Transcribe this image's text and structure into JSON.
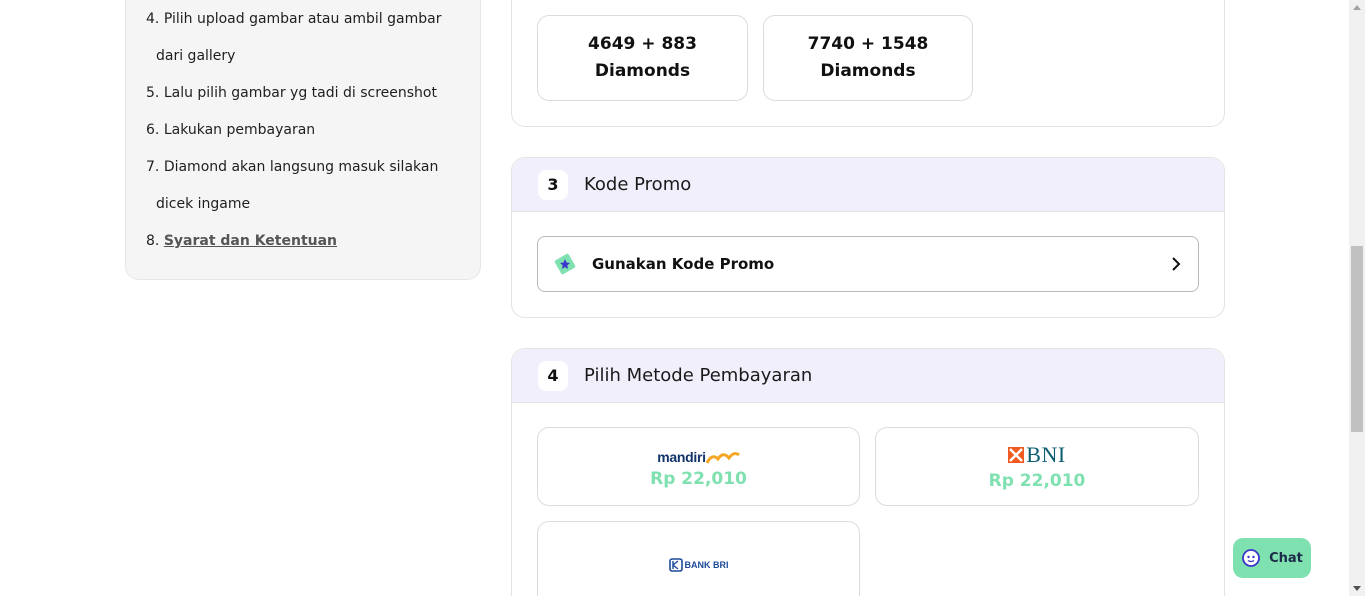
{
  "instructions": {
    "steps": [
      {
        "number": "4.",
        "text": "Pilih upload gambar atau ambil gambar",
        "continuation": "dari gallery"
      },
      {
        "number": "5.",
        "text": "Lalu pilih gambar yg tadi di screenshot"
      },
      {
        "number": "6.",
        "text": "Lakukan pembayaran"
      },
      {
        "number": "7.",
        "text": "Diamond akan langsung masuk silakan",
        "continuation": "dicek ingame"
      },
      {
        "number": "8.",
        "link_text": "Syarat dan Ketentuan"
      }
    ]
  },
  "nominal": {
    "options": [
      {
        "amount": "4649 + 883",
        "unit": "Diamonds"
      },
      {
        "amount": "7740 + 1548",
        "unit": "Diamonds"
      }
    ]
  },
  "promo_section": {
    "number": "3",
    "title": "Kode Promo",
    "button_label": "Gunakan Kode Promo",
    "icon": "ticket-star-icon"
  },
  "payment_section": {
    "number": "4",
    "title": "Pilih Metode Pembayaran",
    "methods": [
      {
        "name": "mandiri",
        "price": "Rp 22,010"
      },
      {
        "name": "BNI",
        "price": "Rp 22,010"
      },
      {
        "name": "BANK BRI",
        "price": ""
      }
    ]
  },
  "chat": {
    "label": "Chat",
    "icon": "chat-bot-icon"
  },
  "colors": {
    "accent_green": "#7fe0b0",
    "section_header_bg": "#f1effc",
    "mandiri_navy": "#13346b",
    "mandiri_gold": "#f5a623",
    "bni_orange": "#f15a22",
    "bni_teal": "#0d5c70",
    "bri_blue": "#1c4a9c"
  }
}
